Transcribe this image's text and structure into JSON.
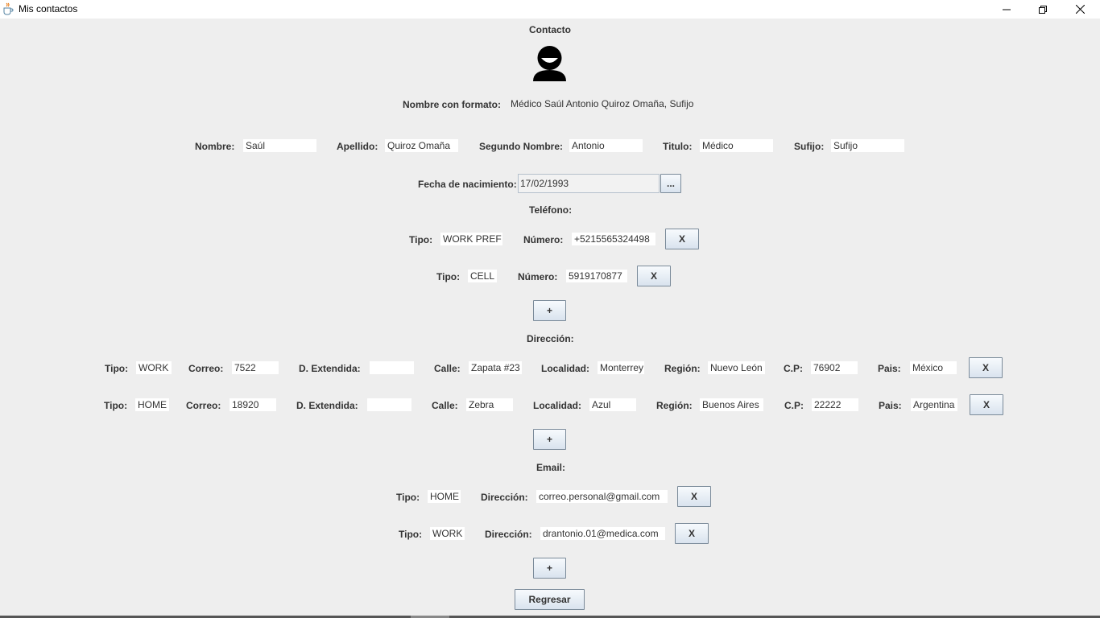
{
  "window": {
    "title": "Mis contactos",
    "icon": "java-cup-icon"
  },
  "header": {
    "title": "Contacto",
    "avatar_icon": "person-icon"
  },
  "formatted_name": {
    "label": "Nombre con formato:",
    "value": "Médico Saúl Antonio Quiroz Omaña, Sufijo"
  },
  "name_fields": {
    "nombre": {
      "label": "Nombre:",
      "value": "Saúl"
    },
    "apellido": {
      "label": "Apellido:",
      "value": "Quiroz Omaña"
    },
    "segundo": {
      "label": "Segundo Nombre:",
      "value": "Antonio"
    },
    "titulo": {
      "label": "Titulo:",
      "value": "Médico"
    },
    "sufijo": {
      "label": "Sufijo:",
      "value": "Sufijo"
    }
  },
  "birthdate": {
    "label": "Fecha de nacimiento:",
    "value": "17/02/1993",
    "picker_label": "..."
  },
  "phones": {
    "title": "Teléfono:",
    "items": [
      {
        "type_label": "Tipo:",
        "type": "WORK PREF",
        "number_label": "Número:",
        "number": "+5215565324498",
        "remove": "X"
      },
      {
        "type_label": "Tipo:",
        "type": "CELL",
        "number_label": "Número:",
        "number": "5919170877",
        "remove": "X"
      }
    ],
    "add": "+"
  },
  "addresses": {
    "title": "Dirección:",
    "items": [
      {
        "type_label": "Tipo:",
        "type": "WORK",
        "correo_label": "Correo:",
        "correo": "7522",
        "ext_label": "D. Extendida:",
        "ext": "",
        "calle_label": "Calle:",
        "calle": "Zapata #23",
        "localidad_label": "Localidad:",
        "localidad": "Monterrey",
        "region_label": "Región:",
        "region": "Nuevo León",
        "cp_label": "C.P:",
        "cp": "76902",
        "pais_label": "Pais:",
        "pais": "México",
        "remove": "X"
      },
      {
        "type_label": "Tipo:",
        "type": "HOME",
        "correo_label": "Correo:",
        "correo": "18920",
        "ext_label": "D. Extendida:",
        "ext": "",
        "calle_label": "Calle:",
        "calle": "Zebra",
        "localidad_label": "Localidad:",
        "localidad": "Azul",
        "region_label": "Región:",
        "region": "Buenos Aires",
        "cp_label": "C.P:",
        "cp": "22222",
        "pais_label": "Pais:",
        "pais": "Argentina",
        "remove": "X"
      }
    ],
    "add": "+"
  },
  "emails": {
    "title": "Email:",
    "items": [
      {
        "type_label": "Tipo:",
        "type": "HOME",
        "address_label": "Dirección:",
        "address": "correo.personal@gmail.com",
        "remove": "X"
      },
      {
        "type_label": "Tipo:",
        "type": "WORK",
        "address_label": "Dirección:",
        "address": "drantonio.01@medica.com",
        "remove": "X"
      }
    ],
    "add": "+"
  },
  "back_button": "Regresar"
}
